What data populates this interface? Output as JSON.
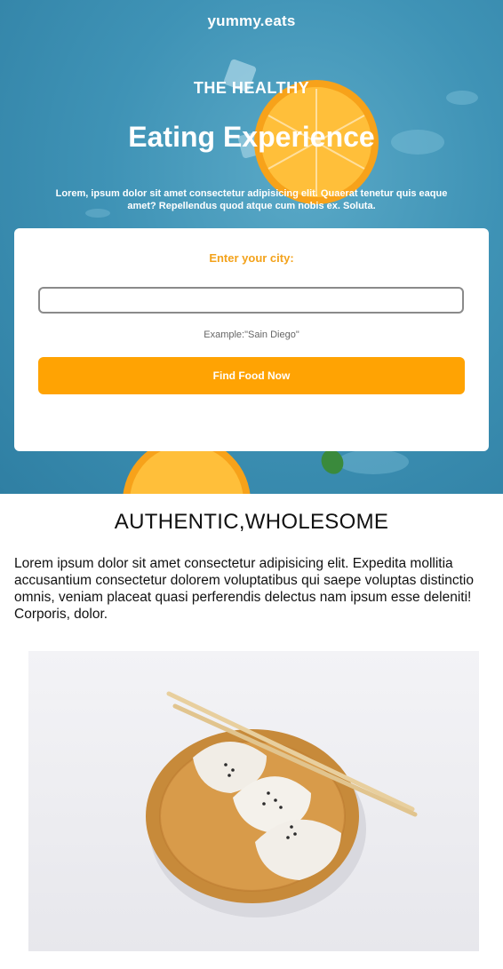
{
  "header": {
    "brand": "yummy.eats"
  },
  "hero": {
    "kicker": "THE HEALTHY",
    "headline": "Eating Experience",
    "subtext": "Lorem, ipsum dolor sit amet consectetur adipisicing elit. Quaerat tenetur quis eaque amet? Repellendus quod atque cum nobis ex. Soluta."
  },
  "search": {
    "label": "Enter your city:",
    "value": "",
    "placeholder": "",
    "hint": "Example:\"Sain Diego\"",
    "button_label": "Find Food Now"
  },
  "section": {
    "title": "AUTHENTIC,WHOLESOME",
    "body": "Lorem ipsum dolor sit amet consectetur adipisicing elit. Expedita mollitia accusantium consectetur dolorem voluptatibus qui saepe voluptas distinctio omnis, veniam placeat quasi perferendis delectus nam ipsum esse deleniti! Corporis, dolor."
  },
  "colors": {
    "accent": "#ffa303",
    "label_orange": "#f3a21b",
    "hero_blue": "#3f93b6"
  },
  "images": {
    "hero_background": "orange-slices-on-water",
    "section_photo": "dumplings-on-wooden-plate"
  }
}
